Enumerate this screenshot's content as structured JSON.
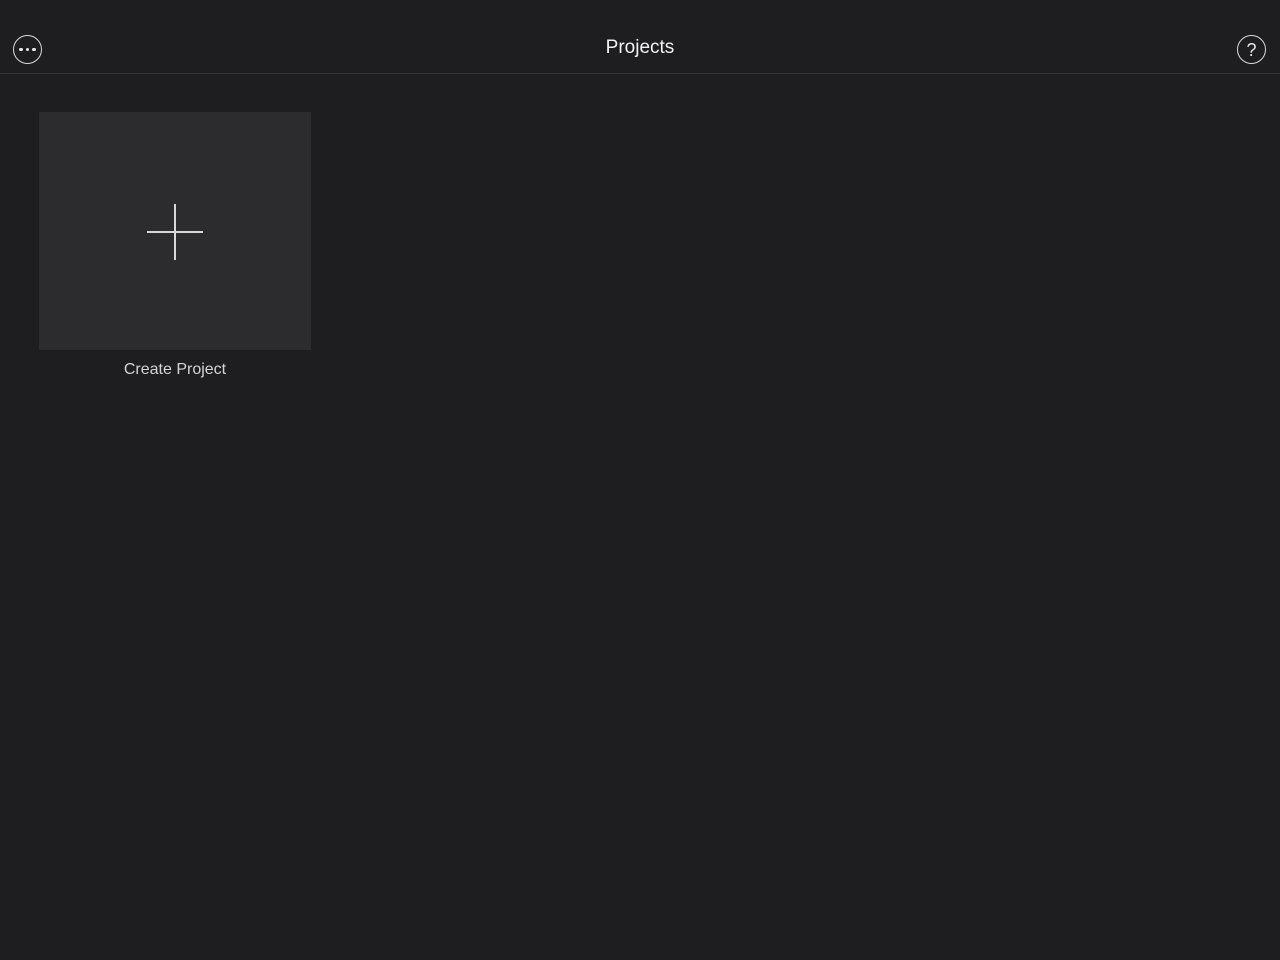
{
  "header": {
    "title": "Projects",
    "more_icon": "ellipsis-circle-icon",
    "help_icon": "question-circle-icon",
    "help_glyph": "?"
  },
  "projects": {
    "create_tile": {
      "icon": "plus-icon",
      "label": "Create Project"
    }
  },
  "colors": {
    "background": "#1e1e20",
    "tile": "#2c2c2e",
    "text": "#f2f2f2"
  }
}
